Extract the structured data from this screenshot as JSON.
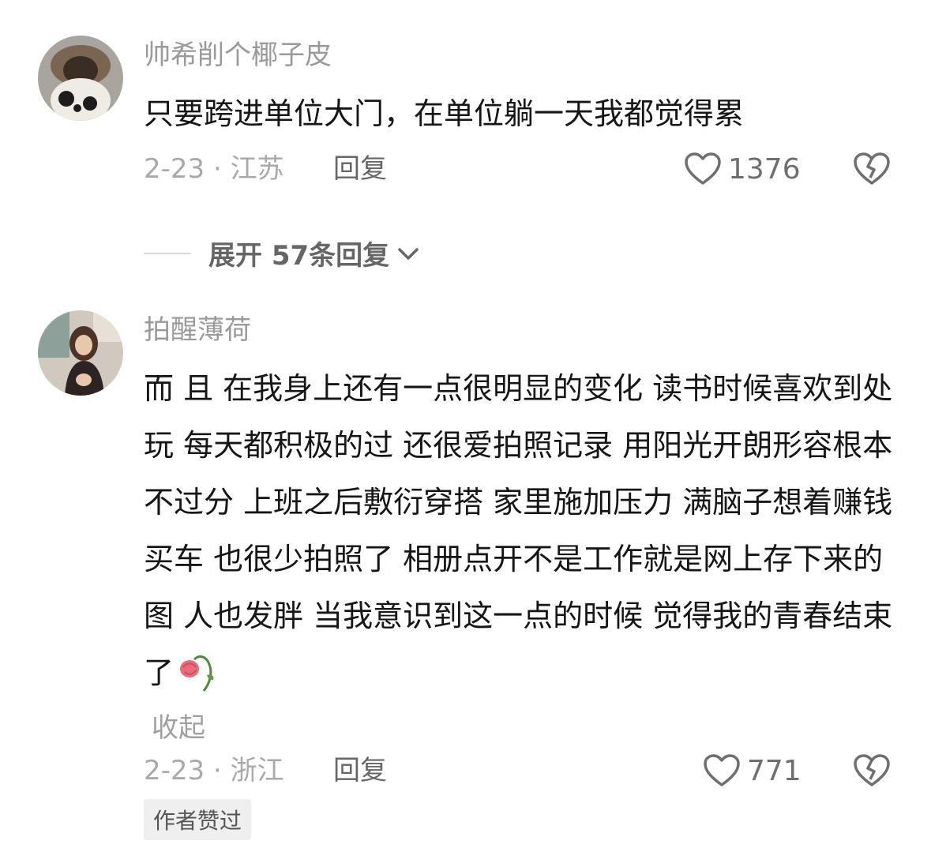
{
  "comments": [
    {
      "username": "帅希削个椰子皮",
      "text": "只要跨进单位大门，在单位躺一天我都觉得累",
      "date_location": "2-23 · 江苏",
      "reply_label": "回复",
      "likes": "1376",
      "expand_label": "展开 57条回复"
    },
    {
      "username": "拍醒薄荷",
      "text": "而 且 在我身上还有一点很明显的变化 读书时候喜欢到处玩 每天都积极的过 还很爱拍照记录 用阳光开朗形容根本不过分 上班之后敷衍穿搭 家里施加压力 满脑子想着赚钱 买车 也很少拍照了 相册点开不是工作就是网上存下来的图 人也发胖 当我意识到这一点的时候 觉得我的青春结束了",
      "collapse_label": "收起",
      "date_location": "2-23 · 浙江",
      "reply_label": "回复",
      "likes": "771",
      "author_badge": "作者赞过",
      "emoji": "wilted-rose-icon"
    }
  ]
}
